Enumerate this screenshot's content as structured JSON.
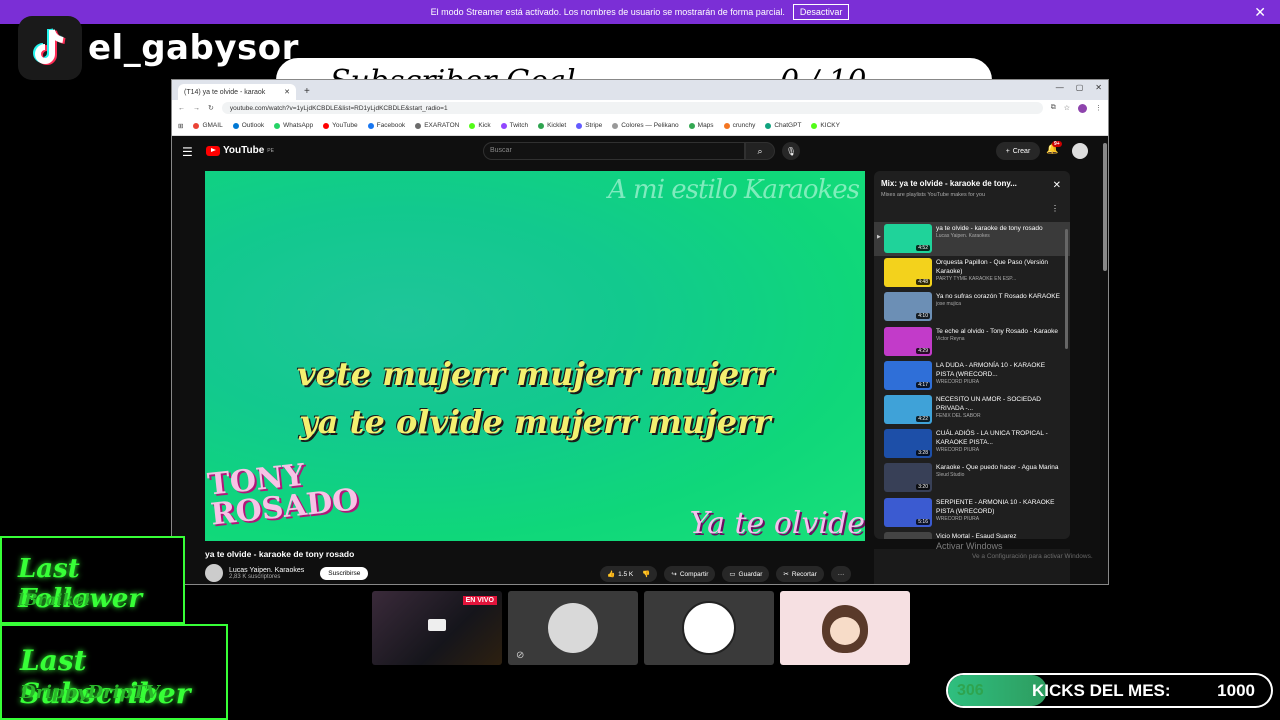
{
  "streamer_banner": {
    "message": "El modo Streamer está activado. Los nombres de usuario se mostrarán de forma parcial.",
    "button": "Desactivar",
    "close": "✕"
  },
  "tiktok": {
    "username": "el_gabysor"
  },
  "subscriber_goal_bar": {
    "left_text": "Subscriber Goal",
    "right_text": "0 / 10"
  },
  "browser": {
    "tab_title": "(T14) ya te olvide - karaok",
    "url": "youtube.com/watch?v=1yLjdKCBDLE&list=RD1yLjdKCBDLE&start_radio=1",
    "bookmarks": [
      {
        "label": "GMAIL",
        "color": "#ea4335"
      },
      {
        "label": "Outlook",
        "color": "#0078d4"
      },
      {
        "label": "WhatsApp",
        "color": "#25d366"
      },
      {
        "label": "YouTube",
        "color": "#ff0000"
      },
      {
        "label": "Facebook",
        "color": "#1877f2"
      },
      {
        "label": "EXARATON",
        "color": "#6b6b6b"
      },
      {
        "label": "Kick",
        "color": "#53fc18"
      },
      {
        "label": "Twitch",
        "color": "#9146ff"
      },
      {
        "label": "Kicklet",
        "color": "#2ea44f"
      },
      {
        "label": "Stripe",
        "color": "#635bff"
      },
      {
        "label": "Colores — Pelikano",
        "color": "#999999"
      },
      {
        "label": "Maps",
        "color": "#34a853"
      },
      {
        "label": "crunchy",
        "color": "#f47521"
      },
      {
        "label": "ChatGPT",
        "color": "#10a37f"
      },
      {
        "label": "KICKY",
        "color": "#53fc18"
      }
    ]
  },
  "youtube": {
    "logo": "YouTube",
    "logo_region": "PE",
    "search_placeholder": "Buscar",
    "create_label": "Crear",
    "notif_count": "9+",
    "video": {
      "watermark": "A mi estilo Karaokes",
      "lyric_line1": "vete mujerr mujerr mujerr",
      "lyric_line2": "ya te olvide mujerr mujerr",
      "artist_logo_1": "TONY",
      "artist_logo_2": "ROSADO",
      "song_logo": "Ya te olvide"
    },
    "title": "ya te olvide - karaoke de tony rosado",
    "channel": "Lucas Yaipen. Karaokes",
    "subscribers": "2,83 K suscriptores",
    "subscribe": "Suscribirse",
    "likes": "1.5 K",
    "share": "Compartir",
    "save": "Guardar",
    "clip": "Recortar",
    "more": "···",
    "playlist": {
      "title": "Mix: ya te olvide - karaoke de tony...",
      "subtitle": "Mixes are playlists YouTube makes for you",
      "items": [
        {
          "title": "ya te olvide - karaoke de tony rosado",
          "channel": "Lucas Yaipen. Karaokes",
          "duration": "4:52",
          "color": "#1fd39a"
        },
        {
          "title": "Orquesta Papillon - Que Paso (Versión Karaoke)",
          "channel": "PARTY TYME KARAOKE EN ESP...",
          "duration": "4:48",
          "color": "#f3d21c"
        },
        {
          "title": "Ya no sufras corazón T Rosado KARAOKE",
          "channel": "jose mujica",
          "duration": "4:10",
          "color": "#6c8fb5"
        },
        {
          "title": "Te eche al olvido - Tony Rosado - Karaoke",
          "channel": "Victor Reyna",
          "duration": "4:29",
          "color": "#c23bc9"
        },
        {
          "title": "LA DUDA - ARMONÍA 10 - KARAOKE PISTA (WRECORD...",
          "channel": "WRECORD PIURA",
          "duration": "4:17",
          "color": "#2f6fd8"
        },
        {
          "title": "NECESITO UN AMOR - SOCIEDAD PRIVADA -...",
          "channel": "FENIX DEL SABOR",
          "duration": "4:22",
          "color": "#3fa2d8"
        },
        {
          "title": "CUÁL ADIÓS - LA UNICA TROPICAL - KARAOKE PISTA...",
          "channel": "WRECORD PIURA",
          "duration": "3:28",
          "color": "#1d4fa8"
        },
        {
          "title": "Karaoke - Que puedo hacer - Agua Marina",
          "channel": "Sleud Studio",
          "duration": "3:20",
          "color": "#384057"
        },
        {
          "title": "SERPIENTE - ARMONIA 10 - KARAOKE PISTA (WRECORD)",
          "channel": "WRECORD PIURA",
          "duration": "5:16",
          "color": "#3b5bd1"
        },
        {
          "title": "Vicio Mortal - Esaud Suarez",
          "channel": "",
          "duration": "",
          "color": "#444444"
        }
      ]
    },
    "activate_windows": "Activar Windows",
    "activate_windows_sub": "Ve a Configuración para activar Windows."
  },
  "overlays": {
    "last_follower_label": "Last Follower",
    "last_follower_name": "lBraikel",
    "last_subscriber_label": "Last Subscriber",
    "last_subscriber_name": "DrippyDripTV",
    "live_badge": "EN VIVO",
    "kicks_current": "306",
    "kicks_label": "KICKS DEL MES:",
    "kicks_goal": "1000",
    "kicks_progress": 0.306
  }
}
